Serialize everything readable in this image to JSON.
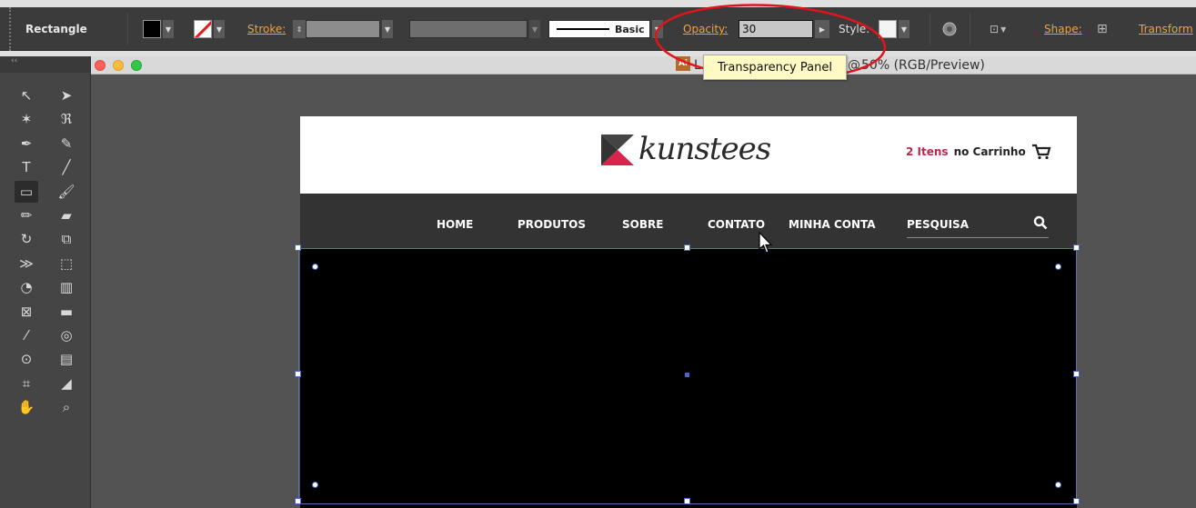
{
  "control_bar": {
    "tool_name": "Rectangle",
    "stroke_label": "Stroke:",
    "brush_label": "Basic",
    "opacity_label": "Opacity:",
    "opacity_value": "30",
    "style_label": "Style:",
    "shape_label": "Shape:",
    "transform_label": "Transform",
    "fill_color": "#000000",
    "accent_color": "#f2a03d"
  },
  "tool_panel": {
    "collapse_glyph": "‹‹",
    "tools": [
      [
        "selection-tool-icon",
        "direct-selection-tool-icon"
      ],
      [
        "magic-wand-tool-icon",
        "lasso-tool-icon"
      ],
      [
        "pen-tool-icon",
        "curvature-tool-icon"
      ],
      [
        "type-tool-icon",
        "line-segment-tool-icon"
      ],
      [
        "rectangle-tool-icon",
        "paintbrush-tool-icon"
      ],
      [
        "pencil-tool-icon",
        "eraser-tool-icon"
      ],
      [
        "rotate-tool-icon",
        "scale-tool-icon"
      ],
      [
        "width-tool-icon",
        "free-transform-tool-icon"
      ],
      [
        "shape-builder-tool-icon",
        "column-graph-tool-icon"
      ],
      [
        "mesh-tool-icon",
        "gradient-tool-icon"
      ],
      [
        "eyedropper-tool-icon",
        "blend-tool-icon"
      ],
      [
        "symbol-sprayer-tool-icon",
        "graph-tool-icon"
      ],
      [
        "artboard-tool-icon",
        "slice-tool-icon"
      ],
      [
        "hand-tool-icon",
        "zoom-tool-icon"
      ]
    ]
  },
  "document": {
    "title": "50% (RGB/Preview)",
    "title_prefix": "L",
    "title_at": "@"
  },
  "tooltip": {
    "text": "Transparency Panel"
  },
  "website": {
    "logo_text": "kunstees",
    "cart_count": "2 Itens",
    "cart_suffix": "no Carrinho",
    "nav": [
      "HOME",
      "PRODUTOS",
      "SOBRE",
      "CONTATO",
      "MINHA CONTA",
      "PESQUISA"
    ]
  }
}
